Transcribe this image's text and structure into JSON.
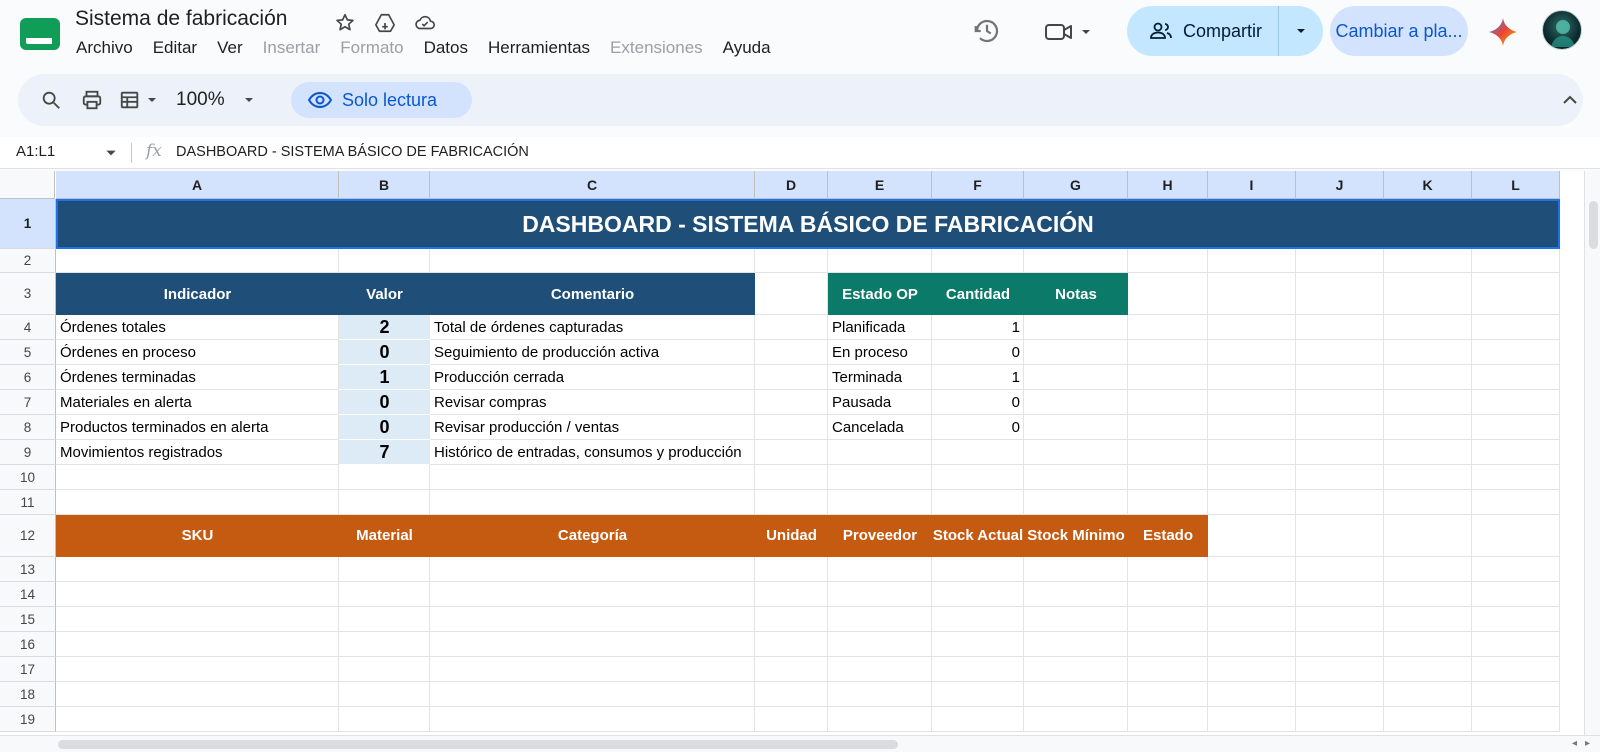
{
  "app": {
    "doc_title": "Sistema de fabricación",
    "menu": [
      {
        "label": "Archivo",
        "enabled": true
      },
      {
        "label": "Editar",
        "enabled": true
      },
      {
        "label": "Ver",
        "enabled": true
      },
      {
        "label": "Insertar",
        "enabled": false
      },
      {
        "label": "Formato",
        "enabled": false
      },
      {
        "label": "Datos",
        "enabled": true
      },
      {
        "label": "Herramientas",
        "enabled": true
      },
      {
        "label": "Extensiones",
        "enabled": false
      },
      {
        "label": "Ayuda",
        "enabled": true
      }
    ],
    "share_label": "Compartir",
    "upgrade_label": "Cambiar a pla...",
    "colors": {
      "accent": "#c2e7ff",
      "banner": "#1f4e79",
      "green_header": "#0b7a68",
      "orange_header": "#c55a11",
      "value_fill": "#ddebf7"
    }
  },
  "toolbar": {
    "zoom": "100%",
    "readonly_label": "Solo lectura",
    "icons": [
      "search-icon",
      "print-icon",
      "view-mode-icon",
      "eye-icon",
      "collapse-icon"
    ]
  },
  "formula_bar": {
    "range": "A1:L1",
    "fx": "fx",
    "content": "DASHBOARD - SISTEMA BÁSICO DE FABRICACIÓN"
  },
  "sheet": {
    "columns": [
      "A",
      "B",
      "C",
      "D",
      "E",
      "F",
      "G",
      "H",
      "I",
      "J",
      "K",
      "L"
    ],
    "rows": [
      "1",
      "2",
      "3",
      "4",
      "5",
      "6",
      "7",
      "8",
      "9",
      "10",
      "11",
      "12",
      "13",
      "14",
      "15",
      "16",
      "17",
      "18",
      "19"
    ],
    "banner": "DASHBOARD - SISTEMA BÁSICO DE FABRICACIÓN",
    "kpi_headers": {
      "indicator": "Indicador",
      "value": "Valor",
      "comment": "Comentario"
    },
    "kpis": [
      {
        "indicator": "Órdenes totales",
        "value": "2",
        "comment": "Total de órdenes capturadas"
      },
      {
        "indicator": "Órdenes en proceso",
        "value": "0",
        "comment": "Seguimiento de producción activa"
      },
      {
        "indicator": "Órdenes terminadas",
        "value": "1",
        "comment": "Producción cerrada"
      },
      {
        "indicator": "Materiales en alerta",
        "value": "0",
        "comment": "Revisar compras"
      },
      {
        "indicator": "Productos terminados en alerta",
        "value": "0",
        "comment": "Revisar producción / ventas"
      },
      {
        "indicator": "Movimientos registrados",
        "value": "7",
        "comment": "Histórico de entradas, consumos y producción"
      }
    ],
    "status_headers": {
      "status": "Estado OP",
      "quantity": "Cantidad",
      "notes": "Notas"
    },
    "statuses": [
      {
        "status": "Planificada",
        "quantity": "1"
      },
      {
        "status": "En proceso",
        "quantity": "0"
      },
      {
        "status": "Terminada",
        "quantity": "1"
      },
      {
        "status": "Pausada",
        "quantity": "0"
      },
      {
        "status": "Cancelada",
        "quantity": "0"
      }
    ],
    "material_headers": [
      "SKU",
      "Material",
      "Categoría",
      "Unidad",
      "Proveedor",
      "Stock Actual",
      "Stock Mínimo",
      "Estado"
    ]
  }
}
